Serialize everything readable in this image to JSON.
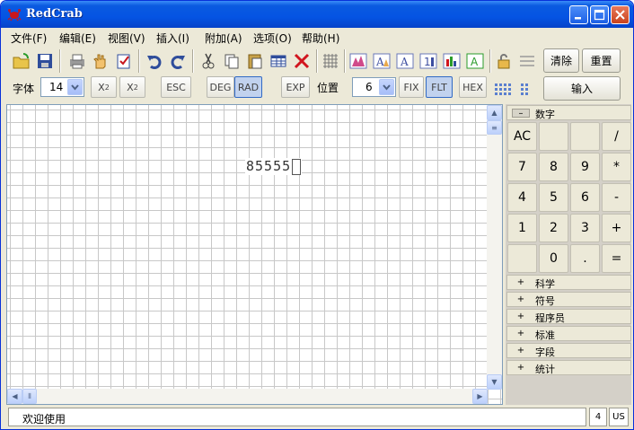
{
  "window": {
    "title": "RedCrab"
  },
  "menu": [
    "文件(F)",
    "编辑(E)",
    "视图(V)",
    "插入(I)",
    "附加(A)",
    "选项(O)",
    "帮助(H)"
  ],
  "toolbar": {
    "clear_label": "清除",
    "reset_label": "重置",
    "input_label": "输入",
    "font_label": "字体",
    "font_size": "14",
    "superscript_label": "X",
    "superscript_exp": "2",
    "subscript_label": "X",
    "subscript_idx": "2",
    "esc_label": "ESC",
    "deg_label": "DEG",
    "rad_label": "RAD",
    "exp_label": "EXP",
    "position_label": "位置",
    "position_value": "6",
    "fix_label": "FIX",
    "flt_label": "FLT",
    "hex_label": "HEX"
  },
  "canvas": {
    "expression": "85555"
  },
  "panel": {
    "digits_label": "数字",
    "keys": [
      "AC",
      "",
      "",
      "/",
      "7",
      "8",
      "9",
      "*",
      "4",
      "5",
      "6",
      "-",
      "1",
      "2",
      "3",
      "+",
      "",
      "0",
      ".",
      "="
    ],
    "sections": [
      {
        "toggle": "+",
        "name": "科学"
      },
      {
        "toggle": "+",
        "name": "符号"
      },
      {
        "toggle": "+",
        "name": "程序员"
      },
      {
        "toggle": "+",
        "name": "标准"
      },
      {
        "toggle": "+",
        "name": "字段"
      },
      {
        "toggle": "+",
        "name": "统计"
      }
    ],
    "digits_toggle": "–"
  },
  "status": {
    "message": "欢迎使用",
    "count": "4",
    "locale": "US"
  },
  "colors": {
    "titlebar": "#0554e3",
    "active_toggle": "#c1d2ee",
    "grid": "#c8c8c8"
  }
}
